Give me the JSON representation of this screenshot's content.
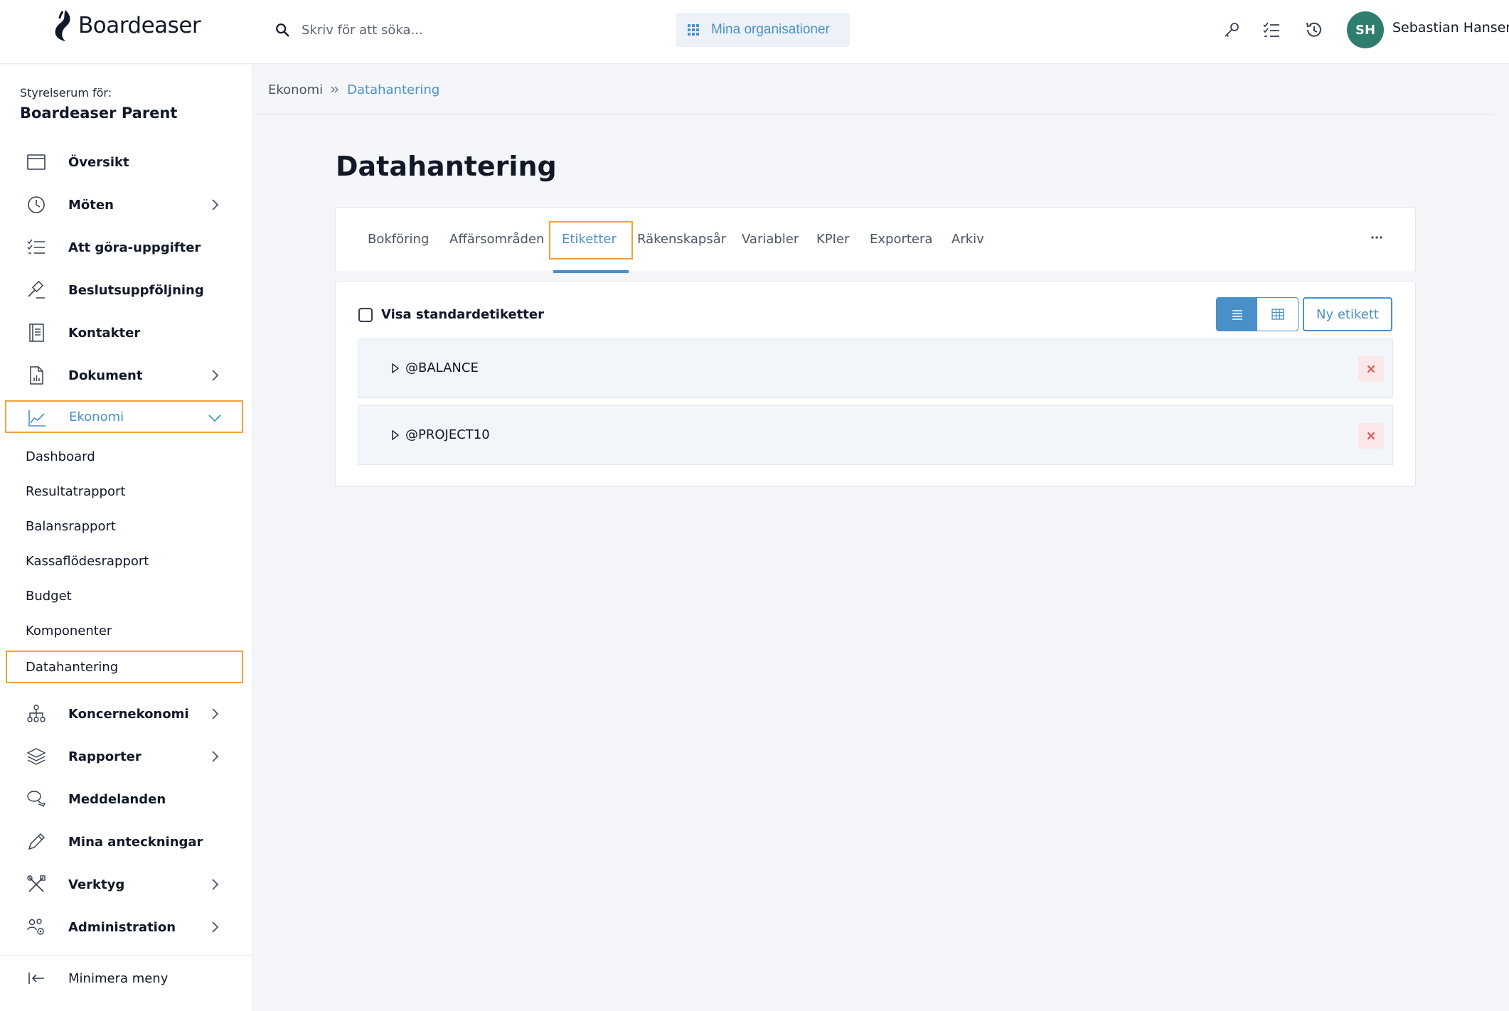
{
  "app": {
    "name": "Boardeaser"
  },
  "header": {
    "search_placeholder": "Skriv för att söka...",
    "org_button": "Mina organisationer",
    "user": {
      "initials": "SH",
      "name": "Sebastian Hansen",
      "avatar_color": "#2f7d6e"
    }
  },
  "sidebar": {
    "room_label": "Styrelserum för:",
    "room_name": "Boardeaser Parent",
    "items": [
      {
        "label": "Översikt",
        "icon": "calendar-icon"
      },
      {
        "label": "Möten",
        "icon": "clock-icon"
      },
      {
        "label": "Att göra-uppgifter",
        "icon": "checklist-icon"
      },
      {
        "label": "Beslutsuppföljning",
        "icon": "gavel-icon"
      },
      {
        "label": "Kontakter",
        "icon": "contacts-book-icon"
      },
      {
        "label": "Dokument",
        "icon": "document-chart-icon"
      },
      {
        "label": "Ekonomi",
        "icon": "line-chart-icon"
      },
      {
        "label": "Koncernekonomi",
        "icon": "org-tree-icon"
      },
      {
        "label": "Rapporter",
        "icon": "layers-icon"
      },
      {
        "label": "Meddelanden",
        "icon": "chat-bubbles-icon"
      },
      {
        "label": "Mina anteckningar",
        "icon": "pencil-icon"
      },
      {
        "label": "Verktyg",
        "icon": "tools-icon"
      },
      {
        "label": "Administration",
        "icon": "users-gear-icon"
      }
    ],
    "ekonomi_sub": [
      "Dashboard",
      "Resultatrapport",
      "Balansrapport",
      "Kassaflödesrapport",
      "Budget",
      "Komponenter",
      "Datahantering"
    ],
    "minimize": "Minimera meny"
  },
  "breadcrumb": {
    "parent": "Ekonomi",
    "current": "Datahantering"
  },
  "page": {
    "title": "Datahantering"
  },
  "tabs": [
    "Bokföring",
    "Affärsområden",
    "Etiketter",
    "Räkenskapsår",
    "Variabler",
    "KPIer",
    "Exportera",
    "Arkiv"
  ],
  "active_tab": "Etiketter",
  "labels_panel": {
    "show_default_label": "Visa standardetiketter",
    "new_label_button": "Ny etikett",
    "rows": [
      "@BALANCE",
      "@PROJECT10"
    ]
  },
  "colors": {
    "accent": "#4a90c8",
    "focus_outline": "#f0a23c",
    "danger_bg": "#fbe7e7",
    "danger": "#d9534f"
  }
}
